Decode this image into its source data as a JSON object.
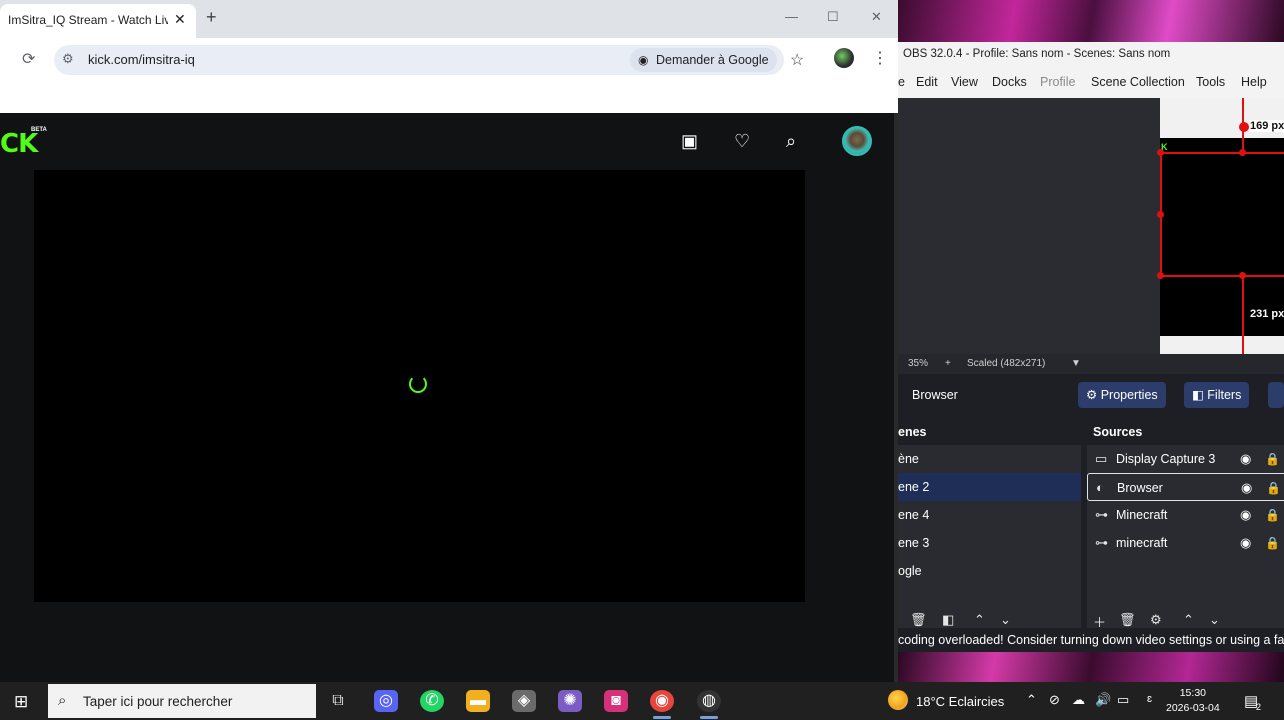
{
  "chrome": {
    "tab_title": "ImSitra_IQ Stream - Watch Live",
    "tab_close": "✕",
    "new_tab": "+",
    "win_min": "—",
    "win_max": "☐",
    "win_close": "✕",
    "url": "kick.com/imsitra-iq",
    "ask_google": "Demander à Google",
    "kick": {
      "logo": "CK",
      "beta": "BETA"
    }
  },
  "obs": {
    "title": "OBS 32.0.4 - Profile: Sans nom - Scenes: Sans nom",
    "menu": [
      "e",
      "Edit",
      "View",
      "Docks",
      "Profile",
      "Scene Collection",
      "Tools",
      "Help"
    ],
    "preview": {
      "width_label": "169 px",
      "height_label": "231 px",
      "kick_mark": "K"
    },
    "status": {
      "zoom": "35%",
      "plus": "+",
      "scale": "Scaled (482x271)"
    },
    "selected_source": "Browser",
    "properties_label": "Properties",
    "filters_label": "Filters",
    "scenes": {
      "title": "enes",
      "items": [
        "ène",
        "ene 2",
        "ene 4",
        "ene 3",
        "ogle"
      ],
      "selected_index": 1
    },
    "sources": {
      "title": "Sources",
      "items": [
        {
          "label": "Display Capture 3",
          "icon": "monitor-icon"
        },
        {
          "label": "Browser",
          "icon": "globe-icon"
        },
        {
          "label": "Minecraft",
          "icon": "gamepad-icon"
        },
        {
          "label": "minecraft",
          "icon": "gamepad-icon"
        }
      ],
      "selected_index": 1
    },
    "message": "coding overloaded! Consider turning down video settings or using a fa"
  },
  "taskbar": {
    "search_placeholder": "Taper ici pour rechercher",
    "weather": "18°C  Eclaircies",
    "lang": "ɛ",
    "time": "15:30",
    "date": "2026-03-04",
    "notif_count": "2"
  }
}
